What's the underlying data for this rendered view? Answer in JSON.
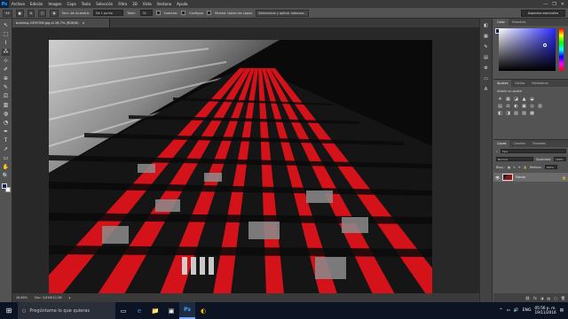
{
  "menubar": {
    "logo": "Ps",
    "items": [
      "Archivo",
      "Edición",
      "Imagen",
      "Capa",
      "Texto",
      "Selección",
      "Filtro",
      "3D",
      "Vista",
      "Ventana",
      "Ayuda"
    ],
    "window_controls": [
      "—",
      "❐",
      "✕"
    ]
  },
  "options": {
    "feather_label": "Tam. de muestra:",
    "feather_value": "De 1 punto",
    "tolerance_label": "Toler.:",
    "tolerance_value": "32",
    "antialias_label": "Suavizar",
    "contiguous_label": "Contiguo",
    "sample_all_label": "Muestr. todas las capas",
    "refine_button": "Seleccionar y aplicar máscara...",
    "workspace": "Aspectos esenciales"
  },
  "document": {
    "tab_title": "building-2399706.jpg al 26,7% (RGB/8)",
    "zoom": "26,66%",
    "doc_info": "Doc: 3,61M/10,5M"
  },
  "panels": {
    "color_tabs": [
      "Color",
      "Muestras"
    ],
    "adjust_tabs": [
      "Ajustes",
      "Estilos",
      "Bibliotecas"
    ],
    "adjust_title": "Añadir un ajuste",
    "adjust_row1": [
      "☀",
      "▦",
      "◪",
      "▲",
      "◒"
    ],
    "adjust_row2": [
      "▤",
      "⚖",
      "◐",
      "▣",
      "◎",
      "▥"
    ],
    "adjust_row3": [
      "◧",
      "◨",
      "▧",
      "▨",
      "▩"
    ],
    "layers_tabs": [
      "Capas",
      "Canales",
      "Trazados"
    ],
    "kind_label": "Tipo",
    "blend_mode": "Normal",
    "opacity_label": "Opacidad:",
    "opacity_value": "100%",
    "lock_label": "Bloq.:",
    "fill_label": "Relleno:",
    "fill_value": "100%",
    "layer_name": "Fondo",
    "layer_lock": "🔒",
    "bottom_icons": [
      "⛓",
      "fx",
      "◑",
      "▤",
      "▢",
      "🗑"
    ]
  },
  "taskbar": {
    "start_icon": "⊞",
    "search_icon": "○",
    "search_placeholder": "Pregúntame lo que quieras",
    "apps": [
      "▭",
      "e",
      "📁",
      "▣",
      "Ps",
      "◐"
    ],
    "tray_icons": [
      "^",
      "▭",
      "🔊"
    ],
    "lang": "ENG",
    "time": "05:56 p. m.",
    "date": "19/11/2016",
    "notif_icon": "▤"
  },
  "tools": [
    "↖",
    "⬚",
    "⌇",
    "⁂",
    "⊹",
    "✐",
    "⊕",
    "✎",
    "⎚",
    "▥",
    "◍",
    "◔",
    "✒",
    "T",
    "↗",
    "▭",
    "✋",
    "🔍"
  ],
  "color_icons": [
    "◧",
    "▦",
    "✎",
    "▤",
    "⚙",
    "▭",
    "A"
  ]
}
